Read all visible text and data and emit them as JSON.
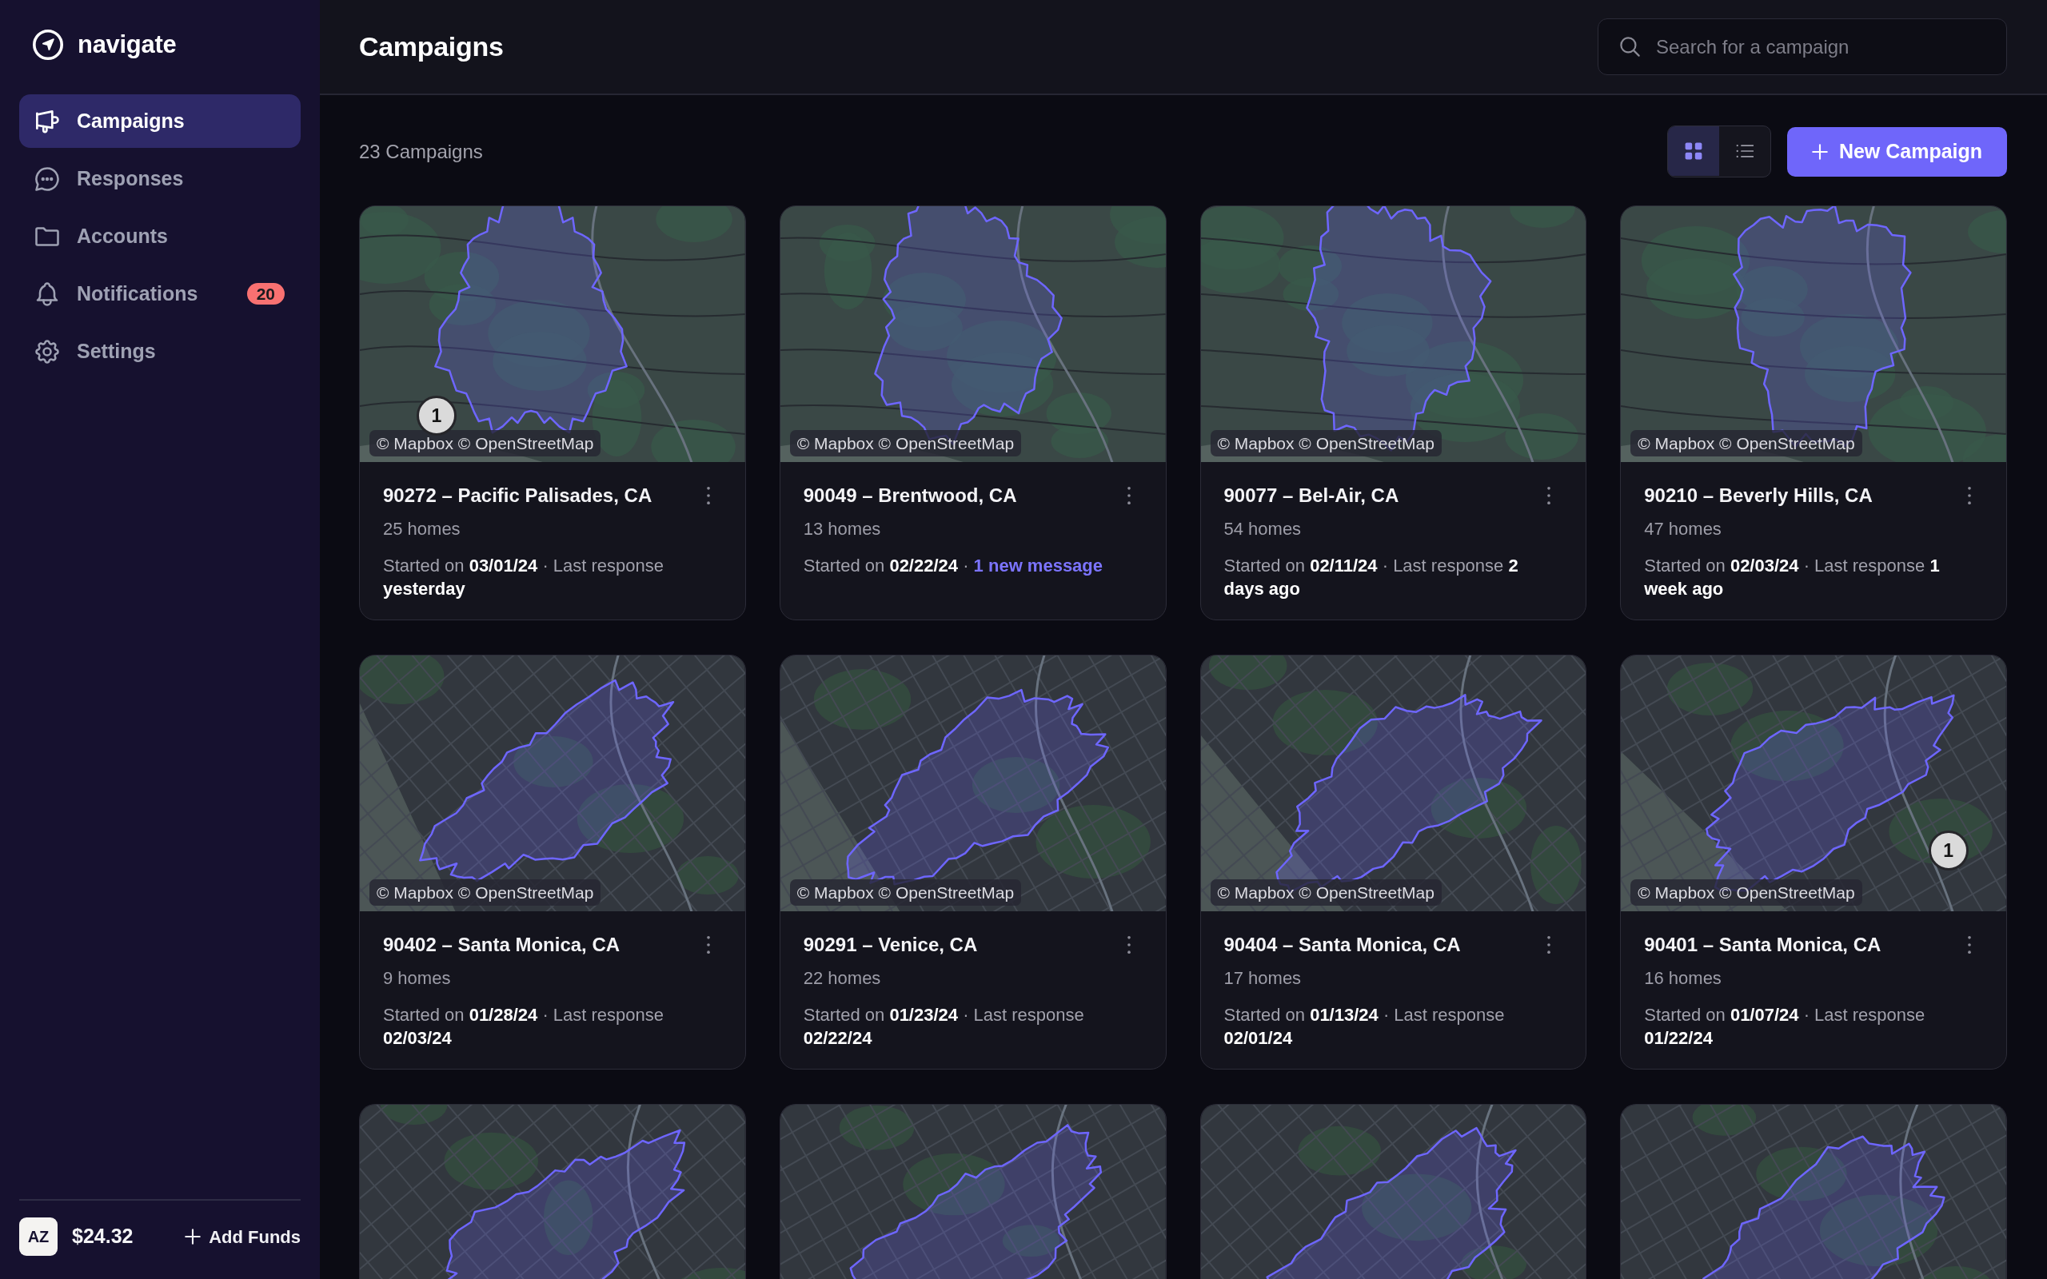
{
  "sidebar": {
    "logo": "navigate",
    "items": [
      {
        "label": "Campaigns",
        "selected": true
      },
      {
        "label": "Responses",
        "selected": false
      },
      {
        "label": "Accounts",
        "selected": false
      },
      {
        "label": "Notifications",
        "selected": false,
        "badge": "20"
      },
      {
        "label": "Settings",
        "selected": false
      }
    ],
    "account": {
      "avatar": "AZ",
      "balance": "$24.32",
      "action": "Add Funds"
    }
  },
  "header": {
    "title": "Campaigns",
    "search": {
      "placeholder": "Search for a campaign"
    }
  },
  "toolbar": {
    "count": "23 Campaigns",
    "views": [
      {
        "selected": true
      },
      {
        "selected": false
      }
    ],
    "new_button": "New Campaign"
  },
  "campaigns": [
    {
      "kind": "full",
      "attribution": "© Mapbox © OpenStreetMap",
      "marker": "1",
      "title": "90272 – Pacific Palisades, CA",
      "homes": "25 homes",
      "status": "Started on **03/01/24** · Last response **yesterday**"
    },
    {
      "kind": "full",
      "attribution": "© Mapbox © OpenStreetMap",
      "title": "90049 – Brentwood, CA",
      "homes": "13 homes",
      "status": "Started on **02/22/24** ·",
      "link": "1 new message"
    },
    {
      "kind": "full",
      "attribution": "© Mapbox © OpenStreetMap",
      "title": "90077 – Bel-Air, CA",
      "homes": "54 homes",
      "status": "Started on **02/11/24** · Last response **2 days ago**"
    },
    {
      "kind": "full",
      "attribution": "© Mapbox © OpenStreetMap",
      "title": "90210 – Beverly Hills, CA",
      "homes": "47 homes",
      "status": "Started on **02/03/24** · Last response **1 week ago**"
    },
    {
      "kind": "full",
      "attribution": "© Mapbox © OpenStreetMap",
      "title": "90402 – Santa Monica, CA",
      "homes": "9 homes",
      "status": "Started on **01/28/24** · Last response **02/03/24**"
    },
    {
      "kind": "full",
      "attribution": "© Mapbox © OpenStreetMap",
      "title": "90291 – Venice, CA",
      "homes": "22 homes",
      "status": "Started on **01/23/24** · Last response **02/22/24**"
    },
    {
      "kind": "full",
      "attribution": "© Mapbox © OpenStreetMap",
      "title": "90404 – Santa Monica, CA",
      "homes": "17 homes",
      "status": "Started on **01/13/24** · Last response **02/01/24**"
    },
    {
      "kind": "full",
      "attribution": "© Mapbox © OpenStreetMap",
      "marker": "1",
      "title": "90401 – Santa Monica, CA",
      "homes": "16 homes",
      "status": "Started on **01/07/24** · Last response **01/22/24**"
    },
    {
      "kind": "partial"
    },
    {
      "kind": "partial"
    },
    {
      "kind": "partial"
    },
    {
      "kind": "partial"
    }
  ]
}
